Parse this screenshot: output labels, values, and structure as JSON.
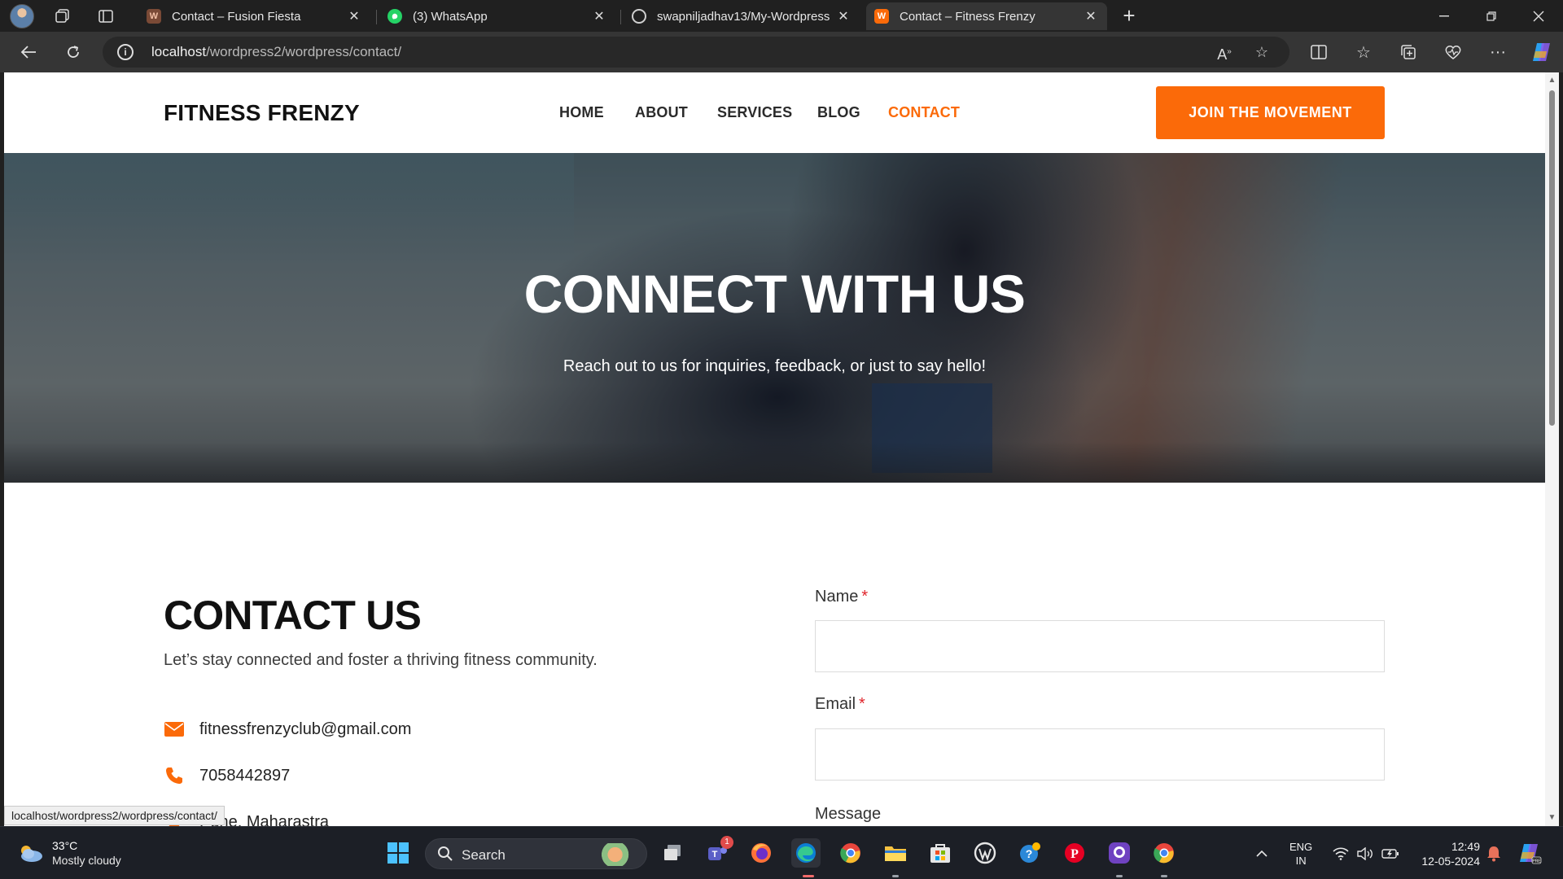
{
  "browser": {
    "tabs": [
      {
        "label": "Contact – Fusion Fiesta",
        "icon": "wordpress-site-icon",
        "active": false
      },
      {
        "label": "(3) WhatsApp",
        "icon": "whatsapp-icon",
        "active": false
      },
      {
        "label": "swapniljadhav13/My-Wordpress",
        "icon": "github-icon",
        "active": false
      },
      {
        "label": "Contact – Fitness Frenzy",
        "icon": "wordpress-site-icon",
        "active": true
      }
    ],
    "new_tab": "+",
    "address": {
      "host": "localhost",
      "path": "/wordpress2/wordpress/contact/"
    },
    "status_link": "localhost/wordpress2/wordpress/contact/"
  },
  "site": {
    "logo": "FITNESS FRENZY",
    "nav": [
      {
        "label": "HOME",
        "current": false
      },
      {
        "label": "ABOUT",
        "current": false
      },
      {
        "label": "SERVICES",
        "current": false
      },
      {
        "label": "BLOG",
        "current": false
      },
      {
        "label": "CONTACT",
        "current": true
      }
    ],
    "cta": "JOIN THE MOVEMENT",
    "accent_color": "#fb6a09"
  },
  "hero": {
    "title": "CONNECT WITH US",
    "subtitle": "Reach out to us for inquiries, feedback, or just to say hello!"
  },
  "contact": {
    "title": "CONTACT US",
    "subtitle": "Let’s stay connected and foster a thriving fitness community.",
    "email": "fitnessfrenzyclub@gmail.com",
    "phone": "7058442897",
    "location": "Pune, Maharastra"
  },
  "form": {
    "name_label": "Name",
    "email_label": "Email",
    "message_label": "Message",
    "required_mark": "*"
  },
  "taskbar": {
    "weather_temp": "33°C",
    "weather_desc": "Mostly cloudy",
    "search_label": "Search",
    "teams_badge": "1",
    "lang_top": "ENG",
    "lang_bottom": "IN",
    "time": "12:49",
    "date": "12-05-2024"
  }
}
